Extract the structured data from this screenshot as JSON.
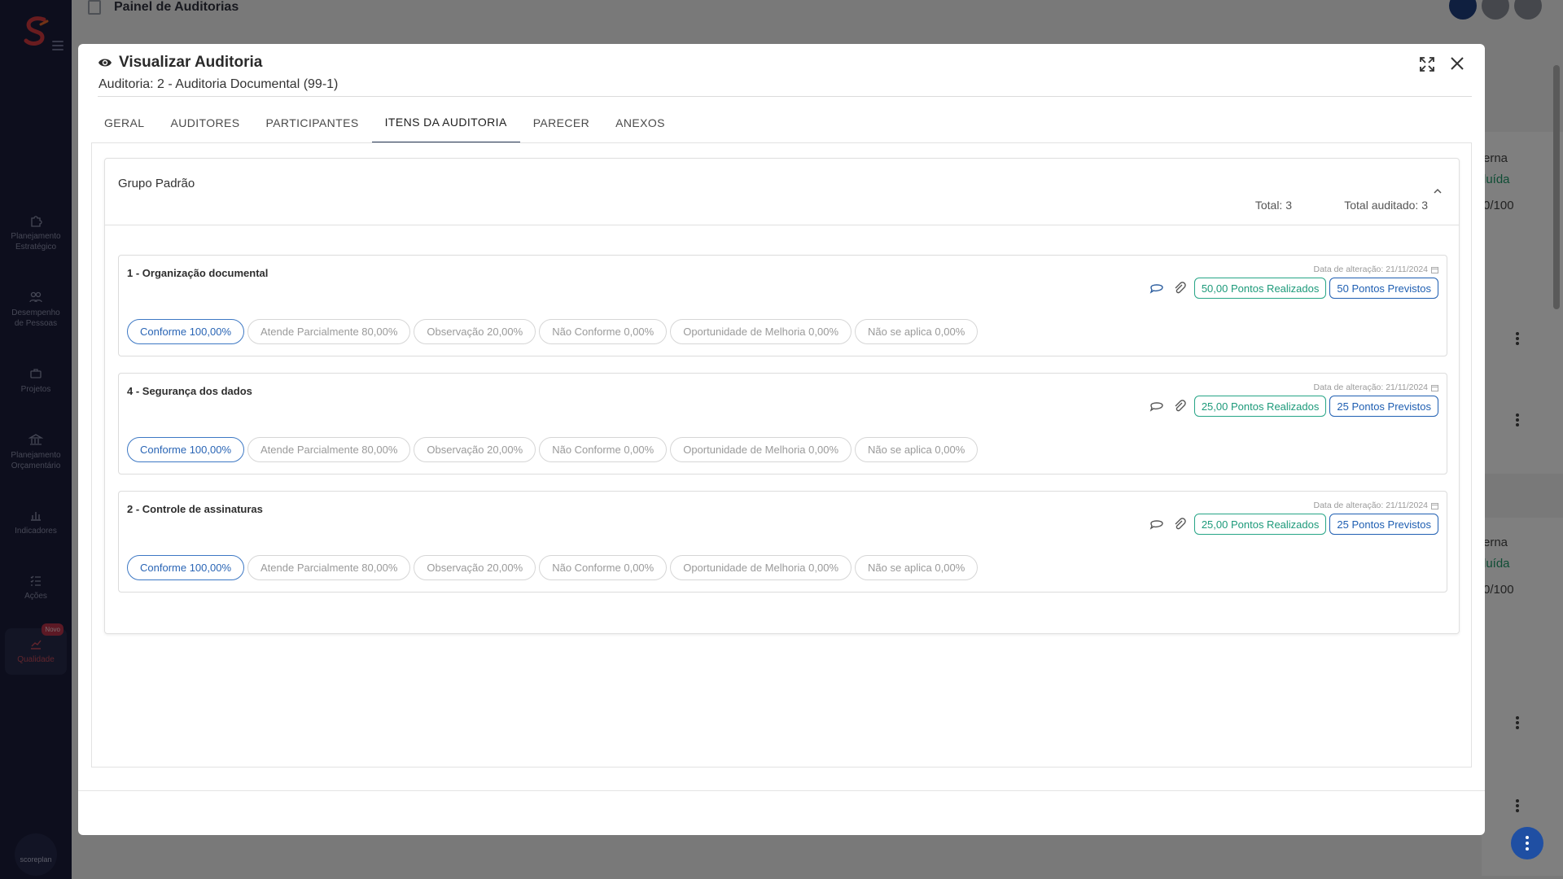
{
  "sidebar": {
    "items": [
      {
        "label_1": "Planejamento",
        "label_2": "Estratégico",
        "icon": "puzzle-icon"
      },
      {
        "label_1": "Desempenho",
        "label_2": "de Pessoas",
        "icon": "people-icon"
      },
      {
        "label_1": "Projetos",
        "label_2": "",
        "icon": "briefcase-icon"
      },
      {
        "label_1": "Planejamento",
        "label_2": "Orçamentário",
        "icon": "bank-icon"
      },
      {
        "label_1": "Indicadores",
        "label_2": "",
        "icon": "bar-chart-icon"
      },
      {
        "label_1": "Ações",
        "label_2": "",
        "icon": "checklist-icon"
      },
      {
        "label_1": "Qualidade",
        "label_2": "",
        "icon": "trend-icon",
        "badge": "Novo"
      }
    ],
    "bottom_logo": "scoreplan"
  },
  "background": {
    "page_title": "Painel de Auditorias",
    "right_texts": [
      "erna",
      "luída",
      "0/100",
      "erna",
      "luída",
      "0/100"
    ]
  },
  "modal": {
    "title": "Visualizar Auditoria",
    "subtitle": "Auditoria: 2 - Auditoria Documental (99-1)",
    "tabs": [
      "GERAL",
      "AUDITORES",
      "PARTICIPANTES",
      "ITENS DA AUDITORIA",
      "PARECER",
      "ANEXOS"
    ],
    "active_tab": "ITENS DA AUDITORIA"
  },
  "group": {
    "name": "Grupo Padrão",
    "total": "Total: 3",
    "total_audited": "Total auditado: 3"
  },
  "items": [
    {
      "title": "1 - Organização documental",
      "date": "Data de alteração: 21/11/2024",
      "realized": "50,00 Pontos Realizados",
      "expected": "50 Pontos Previstos",
      "options": [
        "Conforme 100,00%",
        "Atende Parcialmente 80,00%",
        "Observação 20,00%",
        "Não Conforme 0,00%",
        "Oportunidade de Melhoria 0,00%",
        "Não se aplica 0,00%"
      ],
      "selected": "Conforme 100,00%"
    },
    {
      "title": "4 - Segurança dos dados",
      "date": "Data de alteração: 21/11/2024",
      "realized": "25,00 Pontos Realizados",
      "expected": "25 Pontos Previstos",
      "options": [
        "Conforme 100,00%",
        "Atende Parcialmente 80,00%",
        "Observação 20,00%",
        "Não Conforme 0,00%",
        "Oportunidade de Melhoria 0,00%",
        "Não se aplica 0,00%"
      ],
      "selected": "Conforme 100,00%"
    },
    {
      "title": "2 - Controle de assinaturas",
      "date": "Data de alteração: 21/11/2024",
      "realized": "25,00 Pontos Realizados",
      "expected": "25 Pontos Previstos",
      "options": [
        "Conforme 100,00%",
        "Atende Parcialmente 80,00%",
        "Observação 20,00%",
        "Não Conforme 0,00%",
        "Oportunidade de Melhoria 0,00%",
        "Não se aplica 0,00%"
      ],
      "selected": "Conforme 100,00%"
    }
  ],
  "colors": {
    "sidebar_bg": "#1b1d3a",
    "tab_active": "#2b3c59",
    "realized_green": "#1d9a7a",
    "expected_blue": "#1f5fb2",
    "selected_chip": "#2a65b5"
  }
}
